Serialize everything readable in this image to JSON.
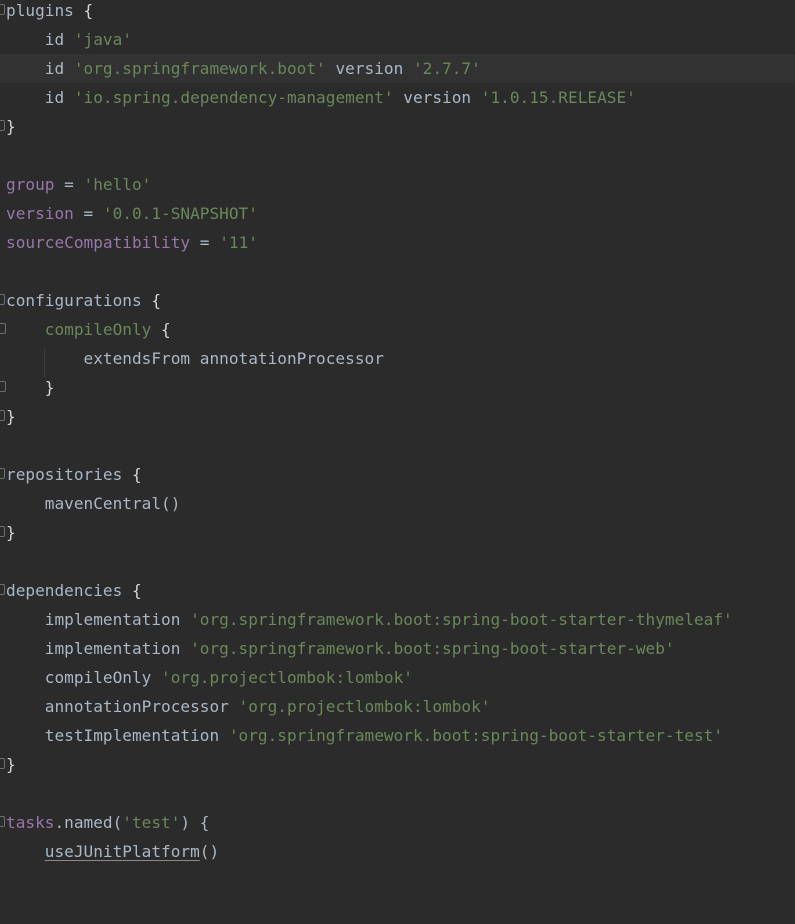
{
  "editor": {
    "file_content": "build.gradle",
    "lines": {
      "l1": {
        "a": "plugins",
        "b": " {"
      },
      "l2": {
        "a": "    id ",
        "b": "'java'"
      },
      "l3": {
        "a": "    id ",
        "b": "'org.springframework.boot'",
        "c": " version ",
        "d": "'2.7.7'"
      },
      "l4": {
        "a": "    id ",
        "b": "'io.spring.dependency-management'",
        "c": " version ",
        "d": "'1.0.15.RELEASE'"
      },
      "l5": {
        "a": "}"
      },
      "l7": {
        "a": "group",
        "b": " = ",
        "c": "'hello'"
      },
      "l8": {
        "a": "version",
        "b": " = ",
        "c": "'0.0.1-SNAPSHOT'"
      },
      "l9": {
        "a": "sourceCompatibility",
        "b": " = ",
        "c": "'11'"
      },
      "l11": {
        "a": "configurations",
        "b": " {"
      },
      "l12": {
        "a": "    ",
        "b": "compileOnly",
        "c": " {"
      },
      "l13": {
        "a": "        extendsFrom annotationProcessor"
      },
      "l14": {
        "a": "    }"
      },
      "l15": {
        "a": "}"
      },
      "l17": {
        "a": "repositories",
        "b": " {"
      },
      "l18": {
        "a": "    mavenCentral()"
      },
      "l19": {
        "a": "}"
      },
      "l21": {
        "a": "dependencies",
        "b": " {"
      },
      "l22": {
        "a": "    implementation ",
        "b": "'org.springframework.boot:spring-boot-starter-thymeleaf'"
      },
      "l23": {
        "a": "    implementation ",
        "b": "'org.springframework.boot:spring-boot-starter-web'"
      },
      "l24": {
        "a": "    compileOnly ",
        "b": "'org.projectlombok:lombok'"
      },
      "l25": {
        "a": "    annotationProcessor ",
        "b": "'org.projectlombok:lombok'"
      },
      "l26": {
        "a": "    testImplementation ",
        "b": "'org.springframework.boot:spring-boot-starter-test'"
      },
      "l27": {
        "a": "}"
      },
      "l29": {
        "a": "tasks",
        "b": ".named(",
        "c": "'test'",
        "d": ") {"
      },
      "l30": {
        "a": "    ",
        "b": "useJUnitPlatform",
        "c": "()"
      }
    }
  },
  "colors": {
    "background": "#2b2b2b",
    "caret_row": "#323232",
    "text": "#a9b7c6",
    "property": "#9876aa",
    "string": "#6a8759"
  }
}
